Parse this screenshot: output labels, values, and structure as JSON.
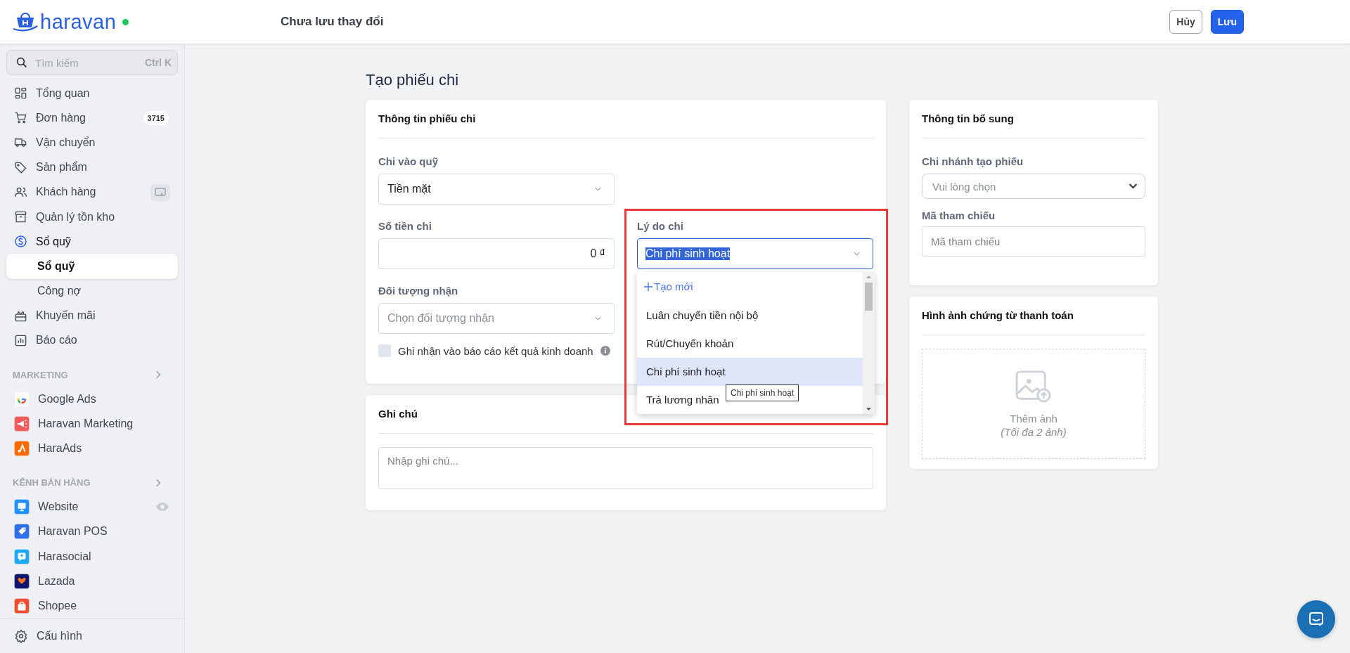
{
  "header": {
    "logo": "haravan",
    "title": "Chưa lưu thay đổi",
    "buttons": [
      {
        "label": "Hủy",
        "kind": "secondary"
      },
      {
        "label": "Lưu",
        "kind": "primary"
      }
    ]
  },
  "sidebar": {
    "search": {
      "placeholder": "Tìm kiếm",
      "shortcut": "Ctrl K"
    },
    "nav": [
      {
        "label": "Tổng quan"
      },
      {
        "label": "Đơn hàng",
        "badge": "3715"
      },
      {
        "label": "Vận chuyển"
      },
      {
        "label": "Sản phẩm"
      },
      {
        "label": "Khách hàng"
      },
      {
        "label": "Quản lý tồn kho"
      },
      {
        "label": "Sổ quỹ",
        "expanded": true,
        "children": [
          {
            "label": "Sổ quỹ",
            "selected": true
          },
          {
            "label": "Công nợ",
            "selected": false
          }
        ]
      },
      {
        "label": "Khuyến mãi"
      },
      {
        "label": "Báo cáo"
      }
    ],
    "sections": [
      {
        "title": "MARKETING",
        "items": [
          {
            "label": "Google Ads"
          },
          {
            "label": "Haravan Marketing"
          },
          {
            "label": "HaraAds"
          }
        ]
      },
      {
        "title": "KÊNH BÁN HÀNG",
        "items": [
          {
            "label": "Website"
          },
          {
            "label": "Haravan POS"
          },
          {
            "label": "Harasocial"
          },
          {
            "label": "Lazada"
          },
          {
            "label": "Shopee"
          }
        ]
      }
    ],
    "footer": "Cấu hình"
  },
  "page_title": "Tạo phiếu chi",
  "payment_info": {
    "title": "Thông tin phiếu chi",
    "fund": {
      "label": "Chi vào quỹ",
      "value": "Tiền mặt"
    },
    "amount": {
      "label": "Số tiền chi",
      "value": "0 ₫"
    },
    "reason": {
      "label": "Lý do chi",
      "value": "Chi phí sinh hoạt",
      "text_selected": true,
      "annotated": true,
      "open": true,
      "tooltip": "Chi phí sinh hoạt",
      "options": [
        {
          "label": "Tạo mới",
          "kind": "create"
        },
        {
          "label": "Luân chuyển tiền nội bộ",
          "kind": "option",
          "selected": false
        },
        {
          "label": "Rút/Chuyển khoản",
          "kind": "option",
          "selected": false
        },
        {
          "label": "Chi phí sinh hoạt",
          "kind": "option",
          "selected": true
        },
        {
          "label": "Trả lương nhân",
          "kind": "option",
          "selected": false
        }
      ]
    },
    "recipient": {
      "label": "Đối tượng nhận",
      "placeholder": "Chọn đối tượng nhận"
    },
    "report_checkbox": {
      "label": "Ghi nhận vào báo cáo kết quả kinh doanh",
      "checked": false
    }
  },
  "notes": {
    "title": "Ghi chú",
    "placeholder": "Nhập ghi chú..."
  },
  "extra_info": {
    "title": "Thông tin bổ sung",
    "branch": {
      "label": "Chi nhánh tạo phiếu",
      "placeholder": "Vui lòng chọn"
    },
    "reference": {
      "label": "Mã tham chiếu",
      "placeholder": "Mã tham chiếu"
    }
  },
  "attachments": {
    "title": "Hình ảnh chứng từ thanh toán",
    "add_label": "Thêm ảnh",
    "limit": "(Tối đa 2 ảnh)"
  }
}
